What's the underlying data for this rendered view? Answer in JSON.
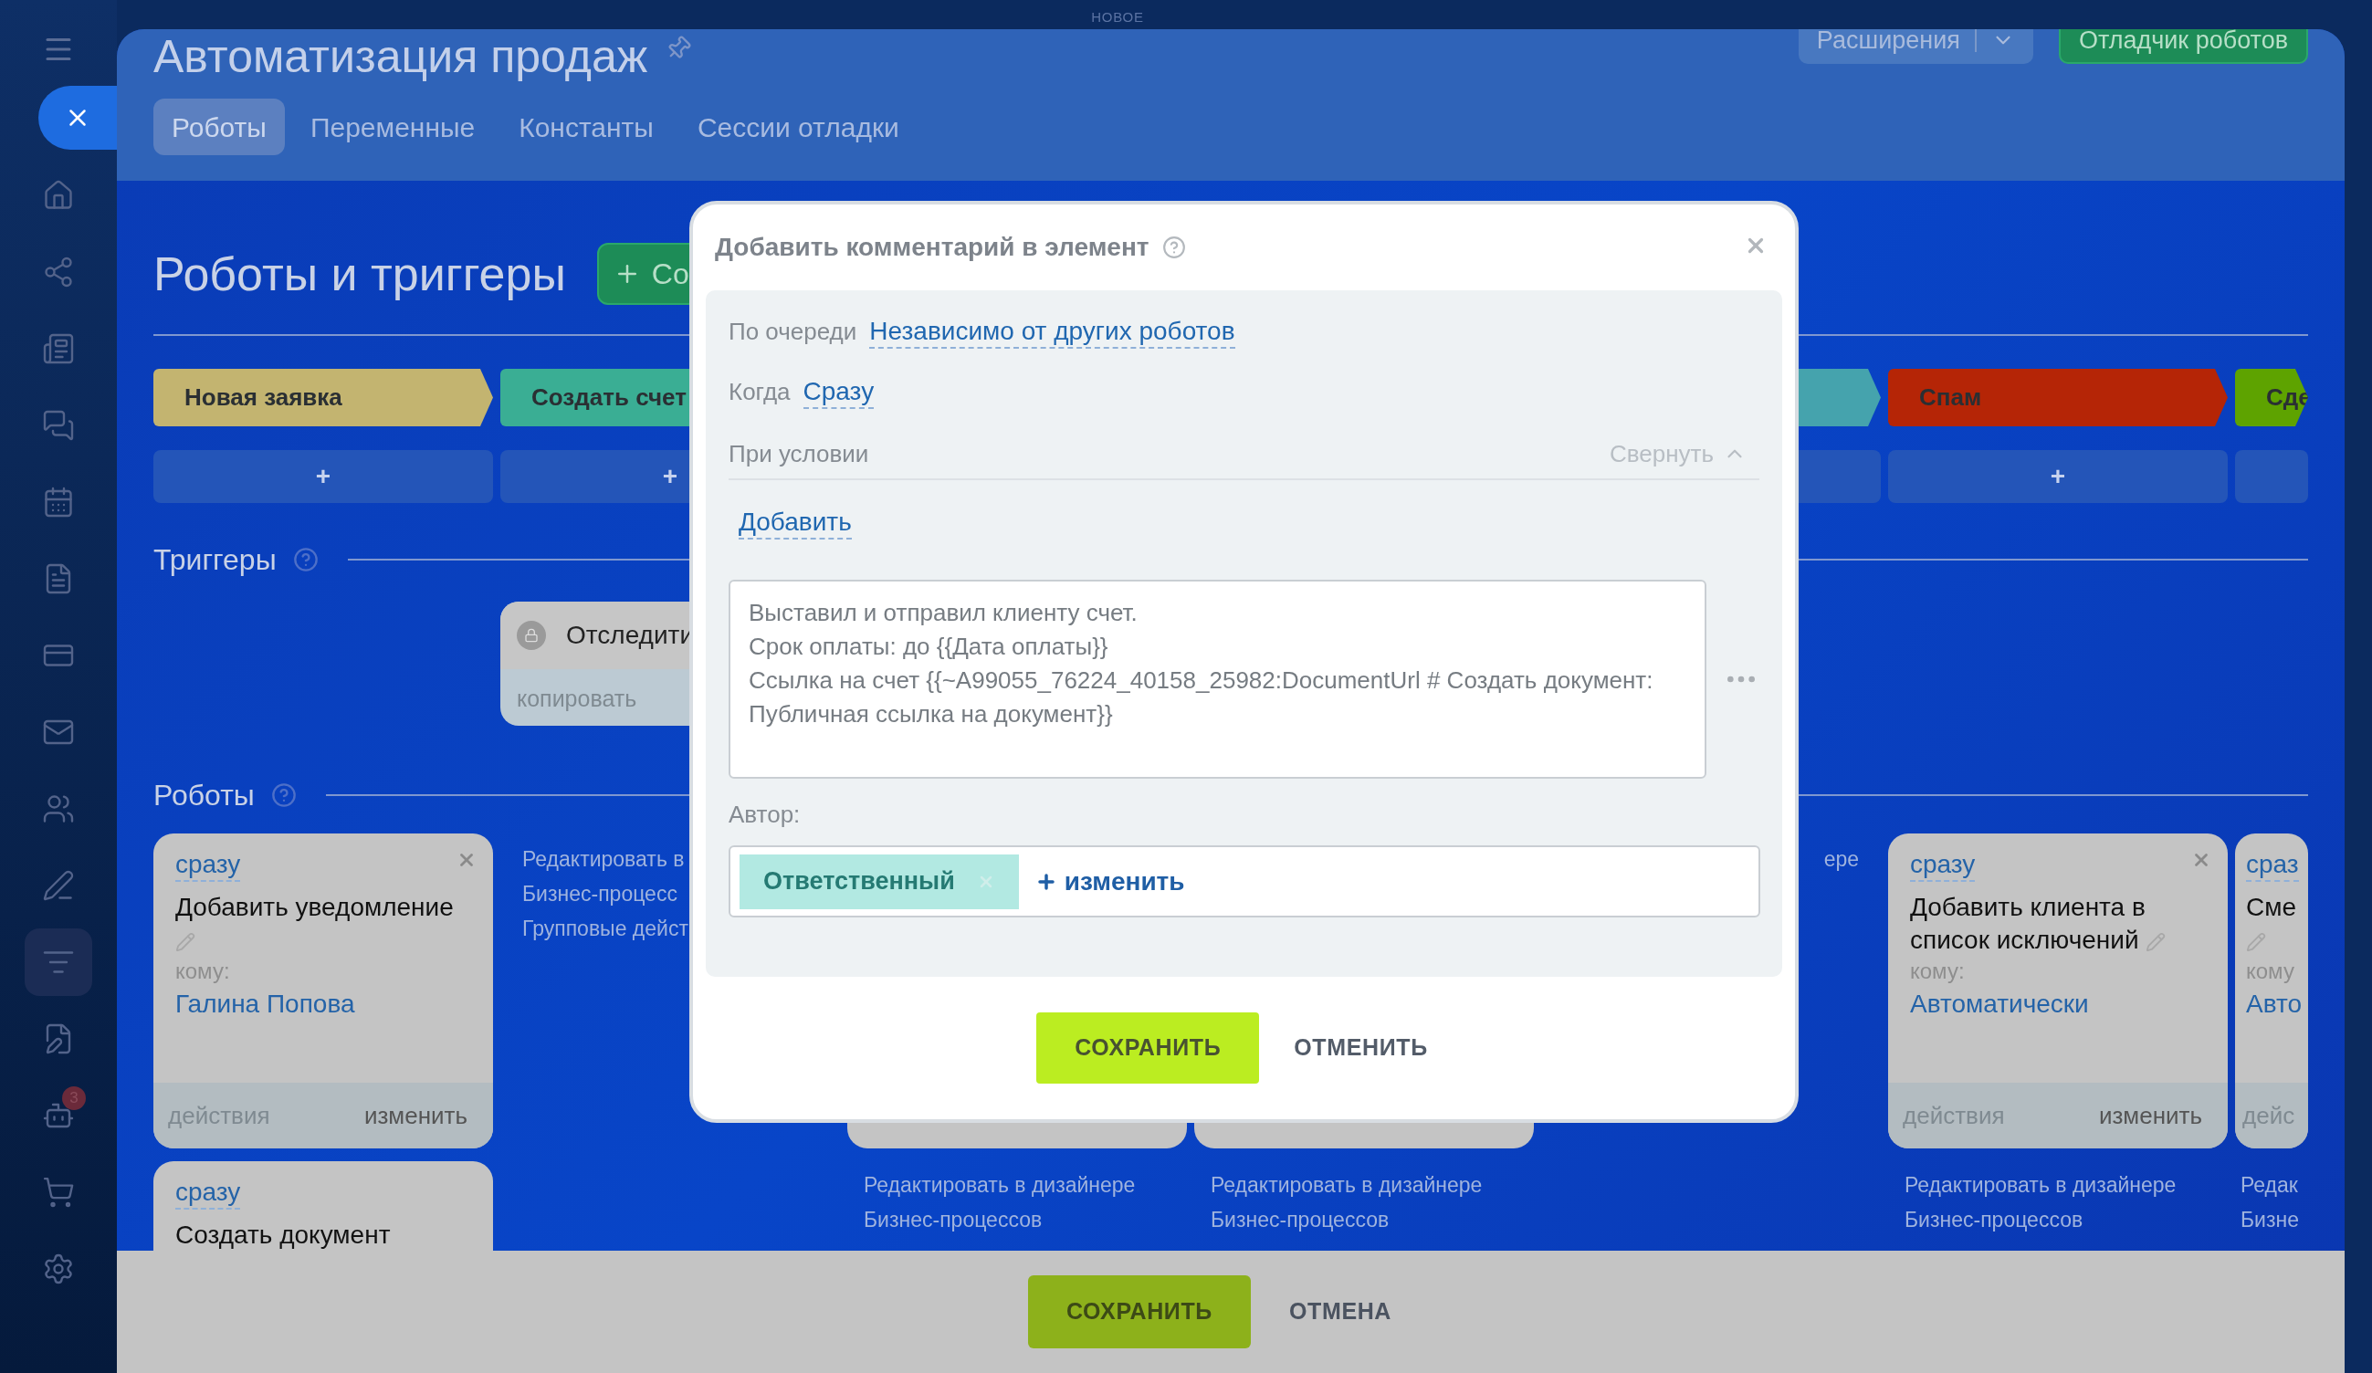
{
  "top_bar": {
    "badge": "НОВОЕ"
  },
  "sidebar": {
    "items": [
      {
        "selected": false
      },
      {
        "selected": true
      },
      {
        "selected": false
      },
      {
        "selected": false
      },
      {
        "selected": false
      },
      {
        "selected": false
      },
      {
        "selected": false
      },
      {
        "selected": false
      },
      {
        "selected": false
      },
      {
        "selected": false
      },
      {
        "selected": false
      },
      {
        "selected": false
      },
      {
        "selected": true
      },
      {
        "selected": false
      },
      {
        "selected": false,
        "badge": "3"
      },
      {
        "selected": false
      },
      {
        "selected": false
      }
    ]
  },
  "header": {
    "title": "Автоматизация продаж",
    "extensions_button": "Расширения",
    "debugger_button": "Отладчик роботов",
    "tabs": [
      {
        "label": "Роботы",
        "selected": true
      },
      {
        "label": "Переменные",
        "selected": false
      },
      {
        "label": "Константы",
        "selected": false
      },
      {
        "label": "Сессии отладки",
        "selected": false
      }
    ]
  },
  "section_title": "Роботы и триггеры",
  "create_button": "Со",
  "stages": [
    {
      "kind": "stage",
      "label": "Новая заявка",
      "color": "#c3b470",
      "add": "+"
    },
    {
      "kind": "stage",
      "label": "Создать счет",
      "color": "#3aae94",
      "add": "+"
    },
    {
      "kind": "covered"
    },
    {
      "kind": "covered"
    },
    {
      "kind": "stage",
      "color": "#45a3ad"
    },
    {
      "kind": "stage",
      "label": "Спам",
      "color": "#b52506",
      "add": "+"
    },
    {
      "kind": "stage",
      "label": "Сде",
      "color": "#5ea300"
    }
  ],
  "triggers": {
    "title": "Триггеры",
    "card": {
      "title": "Отследити",
      "action": "копировать"
    }
  },
  "robots": {
    "title": "Роботы",
    "columns": [
      {
        "cards": [
          {
            "kind": "robot",
            "when": "сразу",
            "title": "Добавить уведомление",
            "to_label": "кому:",
            "to": "Галина Попова",
            "actions": "действия",
            "edit": "изменить"
          },
          {
            "kind": "robot",
            "when": "сразу",
            "title": "Создать документ"
          }
        ]
      },
      {
        "links": [
          "Редактировать в",
          "Бизнес-процесс",
          "Групповые дейст"
        ]
      },
      {
        "cards": [
          {
            "kind": "covered"
          }
        ],
        "links": [
          "Редактировать в дизайнере",
          "Бизнес-процессов"
        ]
      },
      {
        "cards": [
          {
            "kind": "covered"
          }
        ],
        "links": [
          "Редактировать в дизайнере",
          "Бизнес-процессов"
        ]
      },
      {
        "links": [
          "ере"
        ]
      },
      {
        "cards": [
          {
            "kind": "robot",
            "when": "сразу",
            "title": "Добавить клиента в список исключений",
            "to_label": "кому:",
            "to": "Автоматически",
            "actions": "действия",
            "edit": "изменить"
          }
        ],
        "links": [
          "Редактировать в дизайнере",
          "Бизнес-процессов"
        ]
      },
      {
        "cards": [
          {
            "kind": "robot",
            "when": "сраз",
            "title": "Сме",
            "to_label": "кому",
            "to": "Авто",
            "actions": "дейс"
          }
        ],
        "links": [
          "Редак",
          "Бизне"
        ]
      }
    ]
  },
  "modal": {
    "title": "Добавить комментарий в элемент",
    "order_label": "По очереди",
    "order_value": "Независимо от других роботов",
    "when_label": "Когда",
    "when_value": "Сразу",
    "condition_label": "При условии",
    "collapse": "Свернуть",
    "add_condition": "Добавить",
    "comment": "Выставил и отправил клиенту счет.\nСрок оплаты: до {{Дата оплаты}}\nСсылка на счет {{~A99055_76224_40158_25982:DocumentUrl # Создать документ: Публичная ссылка на документ}}",
    "author_label": "Автор:",
    "author_chip": "Ответственный",
    "author_change": "изменить",
    "save": "СОХРАНИТЬ",
    "cancel": "ОТМЕНИТЬ"
  },
  "footer": {
    "save": "СОХРАНИТЬ",
    "cancel": "ОТМЕНА"
  }
}
